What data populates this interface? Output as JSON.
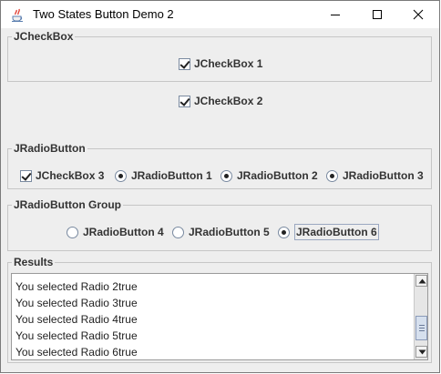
{
  "window": {
    "title": "Two States Button Demo 2",
    "app_icon": "java-coffee-cup-icon",
    "controls": [
      "minimize-icon",
      "maximize-icon",
      "close-icon"
    ]
  },
  "checkbox_group": {
    "legend": "JCheckBox",
    "items": [
      {
        "label": "JCheckBox 1",
        "checked": true
      },
      {
        "label": "JCheckBox 2",
        "checked": true
      }
    ]
  },
  "radio_panel": {
    "legend": "JRadioButton",
    "checkbox3": {
      "label": "JCheckBox 3",
      "checked": true
    },
    "radios": [
      {
        "label": "JRadioButton 1",
        "selected": true
      },
      {
        "label": "JRadioButton 2",
        "selected": true
      },
      {
        "label": "JRadioButton 3",
        "selected": true
      }
    ]
  },
  "radio_group": {
    "legend": "JRadioButton Group",
    "radios": [
      {
        "label": "JRadioButton 4",
        "selected": false
      },
      {
        "label": "JRadioButton 5",
        "selected": false
      },
      {
        "label": "JRadioButton 6",
        "selected": true,
        "focused": true
      }
    ]
  },
  "results": {
    "legend": "Results",
    "lines": [
      "You selected Radio 2true",
      "You selected Radio 3true",
      "You selected Radio 4true",
      "You selected Radio 5true",
      "You selected Radio 6true"
    ]
  }
}
